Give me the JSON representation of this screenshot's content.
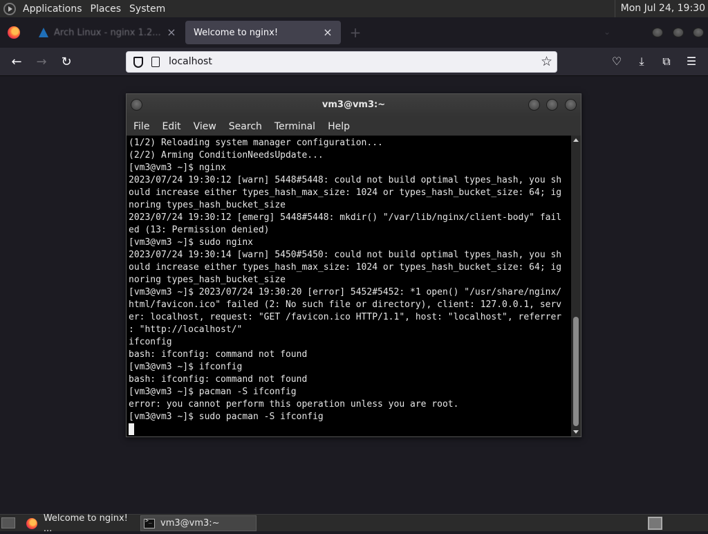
{
  "top_panel": {
    "menus": [
      "Applications",
      "Places",
      "System"
    ],
    "clock": "Mon Jul 24, 19:30"
  },
  "browser": {
    "tabs": [
      {
        "title": "Arch Linux - nginx 1.2...",
        "active": false
      },
      {
        "title": "Welcome to nginx!",
        "active": true
      }
    ],
    "url": "localhost"
  },
  "terminal": {
    "title": "vm3@vm3:~",
    "menu": [
      "File",
      "Edit",
      "View",
      "Search",
      "Terminal",
      "Help"
    ],
    "lines": [
      "(1/2) Reloading system manager configuration...",
      "(2/2) Arming ConditionNeedsUpdate...",
      "[vm3@vm3 ~]$ nginx",
      "2023/07/24 19:30:12 [warn] 5448#5448: could not build optimal types_hash, you sh",
      "ould increase either types_hash_max_size: 1024 or types_hash_bucket_size: 64; ig",
      "noring types_hash_bucket_size",
      "2023/07/24 19:30:12 [emerg] 5448#5448: mkdir() \"/var/lib/nginx/client-body\" fail",
      "ed (13: Permission denied)",
      "[vm3@vm3 ~]$ sudo nginx",
      "2023/07/24 19:30:14 [warn] 5450#5450: could not build optimal types_hash, you sh",
      "ould increase either types_hash_max_size: 1024 or types_hash_bucket_size: 64; ig",
      "noring types_hash_bucket_size",
      "[vm3@vm3 ~]$ 2023/07/24 19:30:20 [error] 5452#5452: *1 open() \"/usr/share/nginx/",
      "html/favicon.ico\" failed (2: No such file or directory), client: 127.0.0.1, serv",
      "er: localhost, request: \"GET /favicon.ico HTTP/1.1\", host: \"localhost\", referrer",
      ": \"http://localhost/\"",
      "ifconfig",
      "bash: ifconfig: command not found",
      "[vm3@vm3 ~]$ ifconfig",
      "bash: ifconfig: command not found",
      "[vm3@vm3 ~]$ pacman -S ifconfig",
      "error: you cannot perform this operation unless you are root.",
      "[vm3@vm3 ~]$ sudo pacman -S ifconfig"
    ]
  },
  "taskbar": {
    "tasks": [
      {
        "label": "Welcome to nginx! ..."
      },
      {
        "label": "vm3@vm3:~"
      }
    ]
  }
}
